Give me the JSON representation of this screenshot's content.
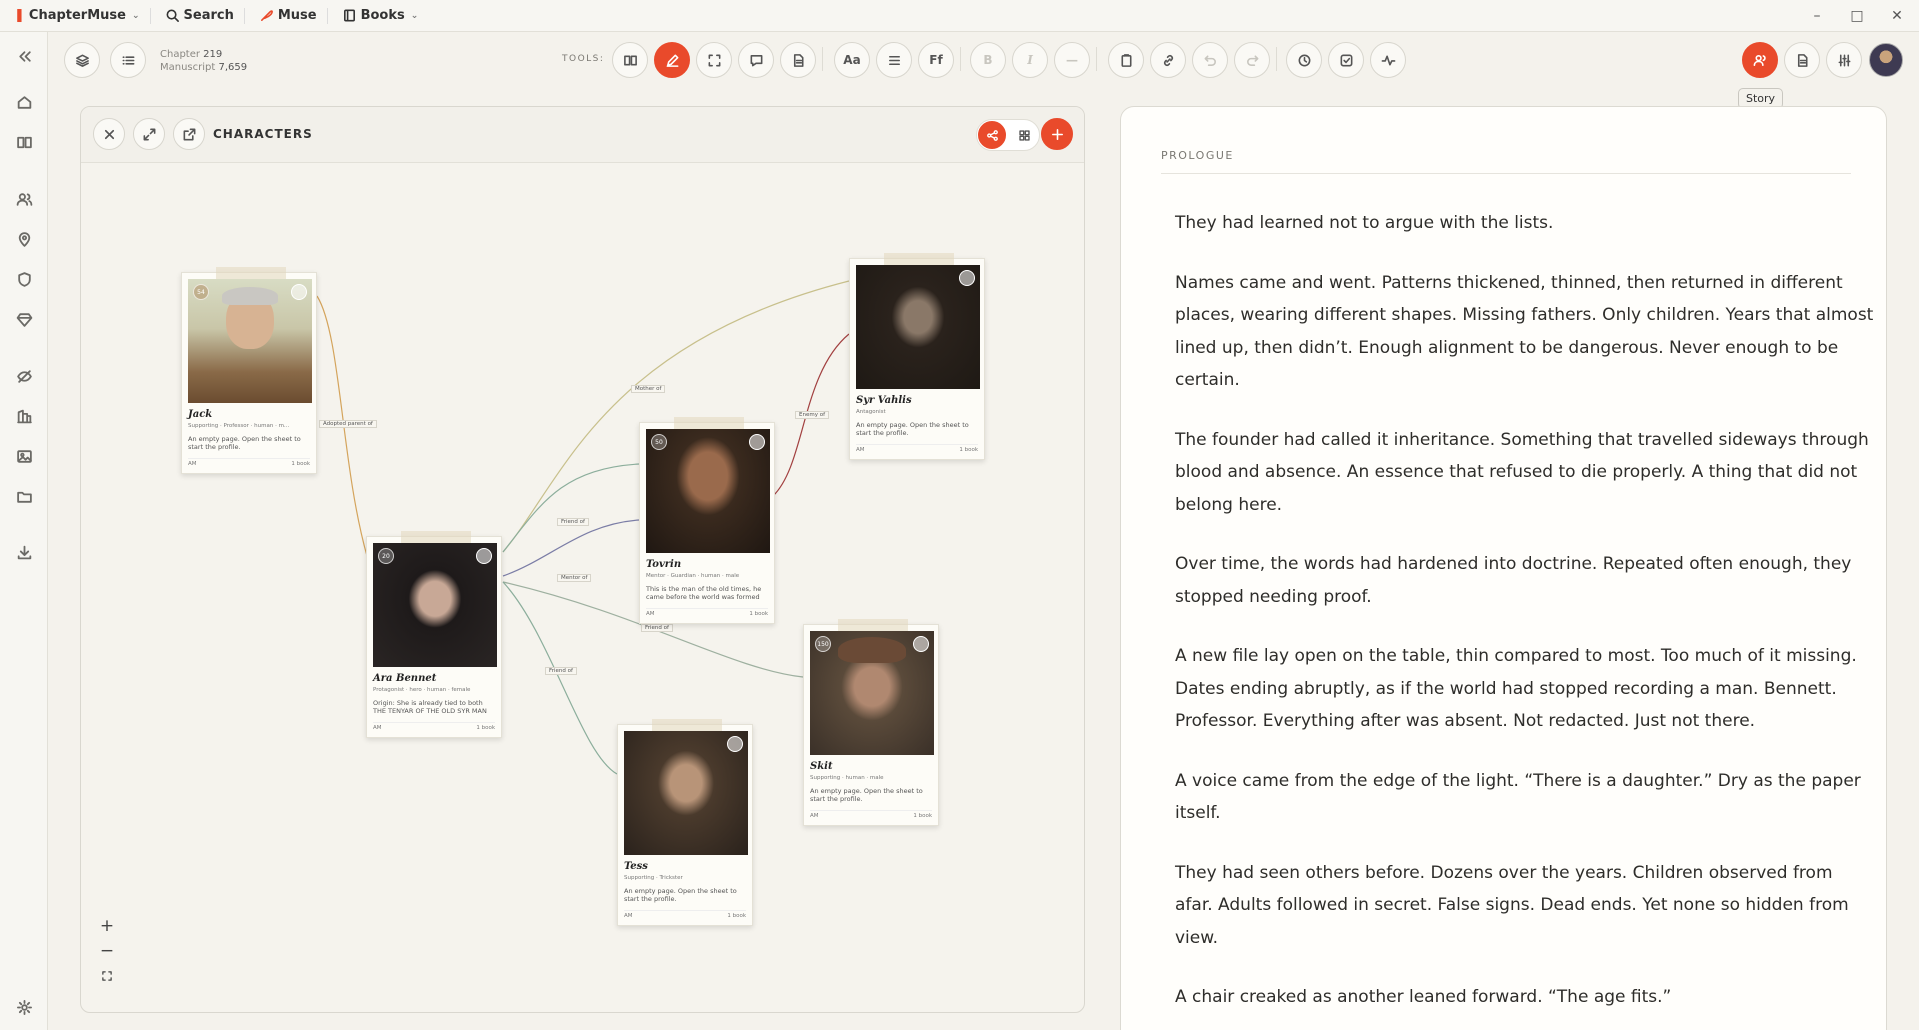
{
  "app": {
    "name": "ChapterMuse",
    "menu": [
      "Search",
      "Muse",
      "Books"
    ]
  },
  "toolbar": {
    "chapter_label": "Chapter",
    "chapter_value": "219",
    "manuscript_label": "Manuscript",
    "manuscript_value": "7,659",
    "tools_label": "TOOLS:",
    "format_buttons": [
      "Aa",
      "Ff"
    ],
    "tooltip": "Story"
  },
  "characters_panel": {
    "title": "CHARACTERS",
    "cards": [
      {
        "name": "Jack",
        "badge": "54",
        "tags": "Supporting · Professor · human · m…",
        "desc": "An empty page. Open the sheet to start the profile.",
        "foot_left": "AM",
        "foot_right": "1 book"
      },
      {
        "name": "Ara Bennet",
        "badge": "20",
        "tags": "Protagonist · hero · human · female",
        "desc": "Origin: She is already tied to both THE TENYAR OF THE OLD SYR MAN",
        "foot_left": "AM",
        "foot_right": "1 book"
      },
      {
        "name": "Tovrin",
        "badge": "50",
        "tags": "Mentor · Guardian · human · male",
        "desc": "This is the man of the old times, he came before the world was formed",
        "foot_left": "AM",
        "foot_right": "1 book"
      },
      {
        "name": "Syr Vahlis",
        "badge": "",
        "tags": "Antagonist",
        "desc": "An empty page. Open the sheet to start the profile.",
        "foot_left": "AM",
        "foot_right": "1 book"
      },
      {
        "name": "Skit",
        "badge": "150",
        "tags": "Supporting · human · male",
        "desc": "An empty page. Open the sheet to start the profile.",
        "foot_left": "AM",
        "foot_right": "1 book"
      },
      {
        "name": "Tess",
        "badge": "",
        "tags": "Supporting · Trickster",
        "desc": "An empty page. Open the sheet to start the profile.",
        "foot_left": "AM",
        "foot_right": "1 book"
      }
    ],
    "edge_labels": [
      "Adopted parent of",
      "Mother of",
      "Enemy of",
      "Friend of",
      "Mentor of",
      "Friend of",
      "Friend of"
    ]
  },
  "prologue": {
    "label": "PROLOGUE",
    "paragraphs": [
      "They had learned not to argue with the lists.",
      "Names came and went. Patterns thickened, thinned, then returned in different places, wearing different shapes. Missing fathers. Only children. Years that almost lined up, then didn’t. Enough alignment to be dangerous. Never enough to be certain.",
      "The founder had called it inheritance. Something that travelled sideways through blood and absence. An essence that refused to die properly. A thing that did not belong here.",
      "Over time, the words had hardened into doctrine. Repeated often enough, they stopped needing proof.",
      "A new file lay open on the table, thin compared to most. Too much of it missing. Dates ending abruptly, as if the world had stopped recording a man. Bennett. Professor. Everything after was absent. Not redacted. Just not there.",
      "A voice came from the edge of the light. “There is a daughter.” Dry as the paper itself.",
      "They had seen others before. Dozens over the years. Children observed from afar. Adults followed in secret. False signs. Dead ends. Yet none so hidden from view.",
      "A chair creaked as another leaned forward. “The age fits.”"
    ]
  },
  "colors": {
    "accent": "#e94a2b",
    "background": "#f4f2ec",
    "panel": "#fffefb"
  }
}
